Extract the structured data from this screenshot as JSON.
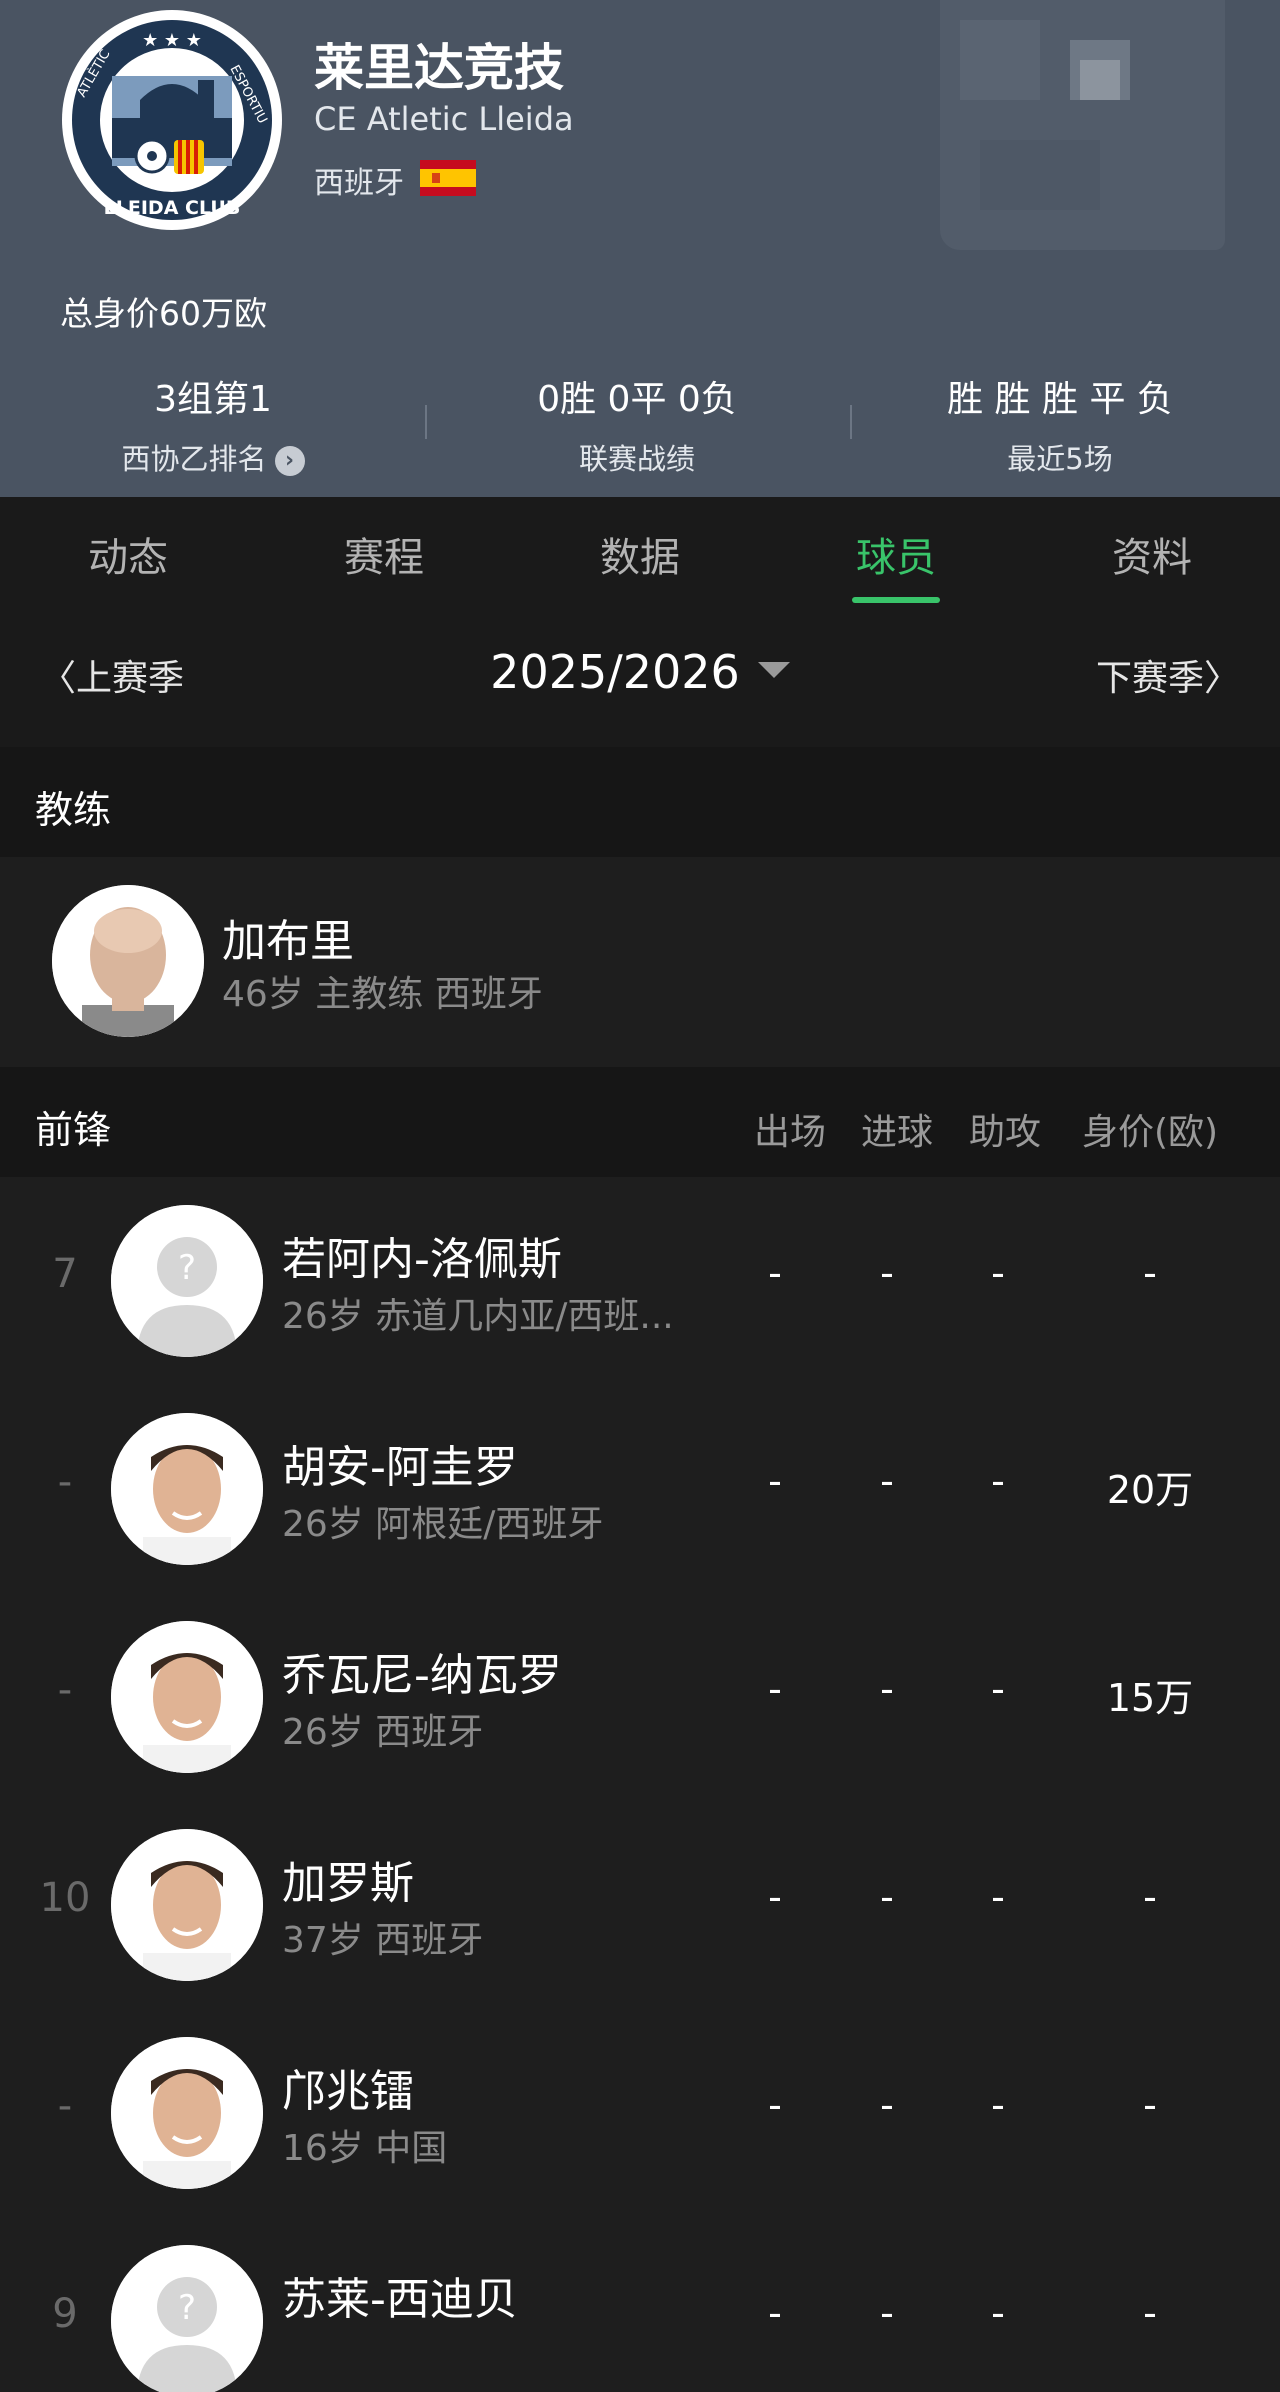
{
  "team": {
    "name_cn": "莱里达竞技",
    "name_en": "CE Atletic Lleida",
    "country": "西班牙",
    "logo_text_top": "ATLÈTIC",
    "logo_text_right": "ESPORTIU",
    "logo_text_bottom": "LLEIDA CLUB",
    "total_value": "总身价60万欧"
  },
  "stats": [
    {
      "value": "3组第1",
      "label": "西协乙排名"
    },
    {
      "value": "0胜 0平 0负",
      "label": "联赛战绩"
    },
    {
      "value": "胜 胜 胜 平 负",
      "label": "最近5场"
    }
  ],
  "tabs": [
    "动态",
    "赛程",
    "数据",
    "球员",
    "资料"
  ],
  "active_tab": "球员",
  "season": {
    "prev": "上赛季",
    "current": "2025/2026",
    "next": "下赛季"
  },
  "coach_section": {
    "title": "教练",
    "coach": {
      "name": "加布里",
      "info": "46岁 主教练 西班牙"
    }
  },
  "forwards_section": {
    "title": "前锋",
    "columns": [
      "出场",
      "进球",
      "助攻",
      "身价(欧)"
    ],
    "players": [
      {
        "number": "7",
        "name": "若阿内-洛佩斯",
        "info": "26岁 赤道几内亚/西班...",
        "apps": "-",
        "goals": "-",
        "assists": "-",
        "value": "-",
        "avatar": "placeholder"
      },
      {
        "number": "-",
        "name": "胡安-阿圭罗",
        "info": "26岁 阿根廷/西班牙",
        "apps": "-",
        "goals": "-",
        "assists": "-",
        "value": "20万",
        "avatar": "photo"
      },
      {
        "number": "-",
        "name": "乔瓦尼-纳瓦罗",
        "info": "26岁 西班牙",
        "apps": "-",
        "goals": "-",
        "assists": "-",
        "value": "15万",
        "avatar": "photo"
      },
      {
        "number": "10",
        "name": "加罗斯",
        "info": "37岁 西班牙",
        "apps": "-",
        "goals": "-",
        "assists": "-",
        "value": "-",
        "avatar": "photo"
      },
      {
        "number": "-",
        "name": "邝兆镭",
        "info": "16岁 中国",
        "apps": "-",
        "goals": "-",
        "assists": "-",
        "value": "-",
        "avatar": "photo"
      },
      {
        "number": "9",
        "name": "苏莱-西迪贝",
        "info": "",
        "apps": "-",
        "goals": "-",
        "assists": "-",
        "value": "-",
        "avatar": "placeholder"
      }
    ]
  },
  "colors": {
    "header_bg": "#4a5462",
    "accent": "#39c46a",
    "body_bg": "#1e1e1e"
  }
}
